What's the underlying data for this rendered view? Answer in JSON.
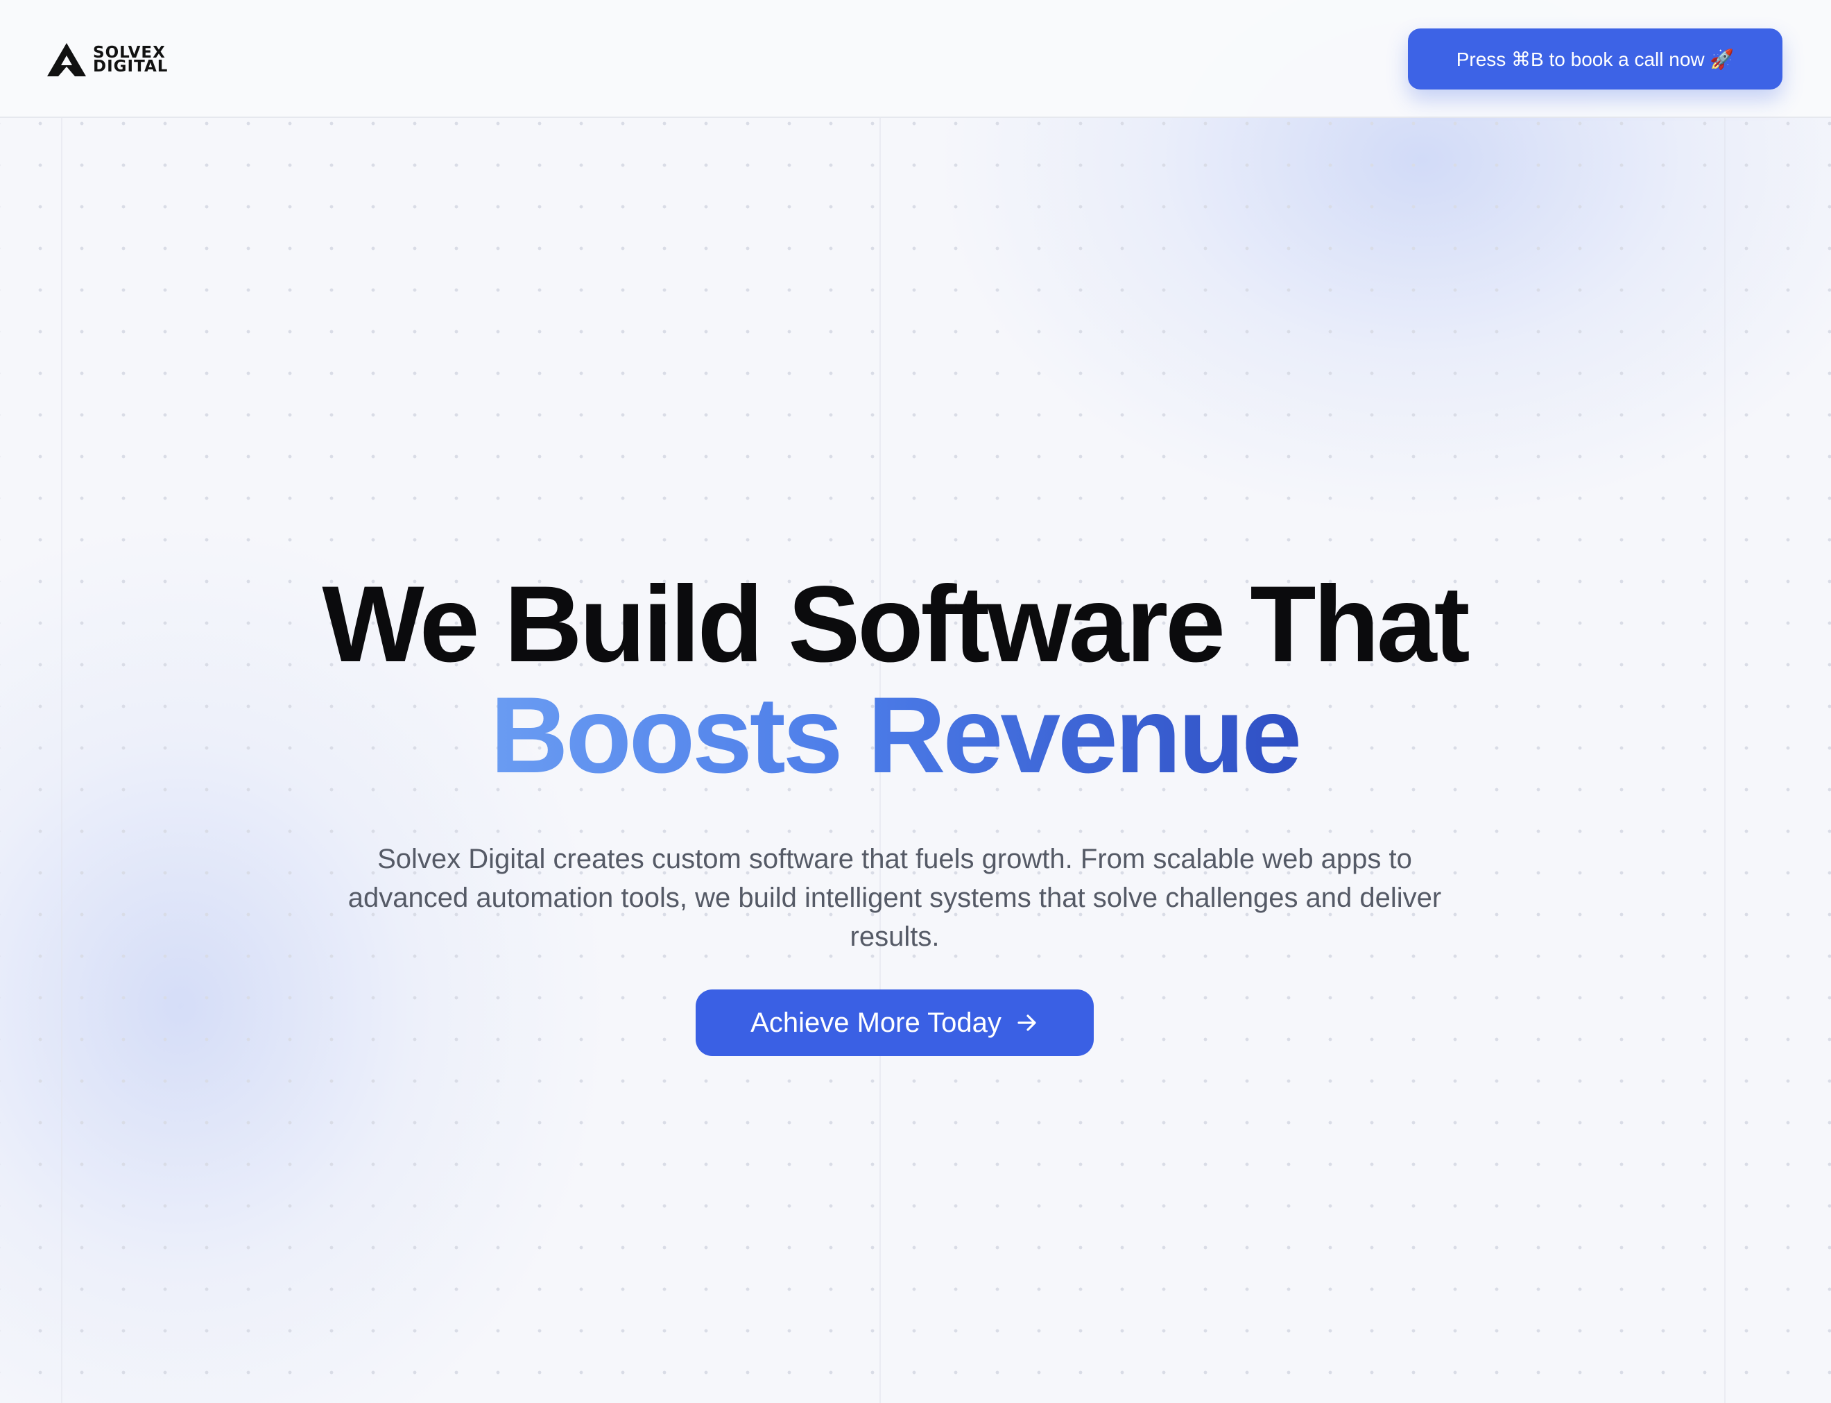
{
  "header": {
    "logo_line1": "SOLVEX",
    "logo_line2": "DIGITAL",
    "cta_label": "Press ⌘B to book a call now 🚀"
  },
  "hero": {
    "title_line1": "We Build Software That",
    "title_line2": "Boosts Revenue",
    "subtitle": "Solvex Digital creates custom software that fuels growth. From scalable web apps to advanced automation tools, we build intelligent systems that solve challenges and deliver results.",
    "cta_label": "Achieve More Today",
    "cta_icon": "arrow-right-icon"
  },
  "colors": {
    "accent": "#3d63e6",
    "gradient_start": "#6a9cf2",
    "gradient_end": "#2f4fc4",
    "title_text": "#0b0b0d",
    "body_text": "#555a66"
  }
}
